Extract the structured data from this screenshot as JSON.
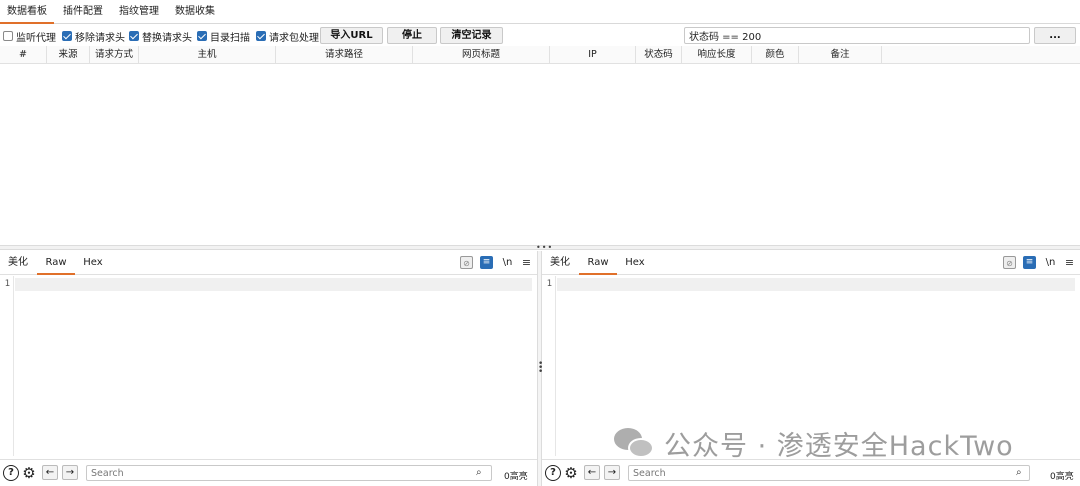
{
  "tabs": [
    {
      "label": "数据看板",
      "active": true
    },
    {
      "label": "插件配置",
      "active": false
    },
    {
      "label": "指纹管理",
      "active": false
    },
    {
      "label": "数据收集",
      "active": false
    }
  ],
  "toolbar": {
    "checkboxes": [
      {
        "label": "监听代理",
        "checked": false
      },
      {
        "label": "移除请求头",
        "checked": true
      },
      {
        "label": "替换请求头",
        "checked": true
      },
      {
        "label": "目录扫描",
        "checked": true
      },
      {
        "label": "请求包处理",
        "checked": true
      }
    ],
    "import_label": "导入URL",
    "stop_label": "停止",
    "clear_label": "清空记录",
    "filter_value": "状态码 == 200",
    "more_label": "..."
  },
  "table": {
    "columns": [
      "#",
      "来源",
      "请求方式",
      "主机",
      "请求路径",
      "网页标题",
      "IP",
      "状态码",
      "响应长度",
      "颜色",
      "备注"
    ],
    "rows": []
  },
  "left_pane": {
    "tabs": [
      {
        "label": "美化",
        "active": false
      },
      {
        "label": "Raw",
        "active": true
      },
      {
        "label": "Hex",
        "active": false
      }
    ],
    "newline_label": "\\n",
    "line_number": "1",
    "search_placeholder": "Search",
    "highlight_count": "0高亮"
  },
  "right_pane": {
    "tabs": [
      {
        "label": "美化",
        "active": false
      },
      {
        "label": "Raw",
        "active": true
      },
      {
        "label": "Hex",
        "active": false
      }
    ],
    "newline_label": "\\n",
    "line_number": "1",
    "search_placeholder": "Search",
    "highlight_count": "0高亮"
  },
  "watermark": {
    "text": "公众号 · 渗透安全HackTwo"
  },
  "colors": {
    "accent": "#e0702a",
    "checkbox_blue": "#2a6db5"
  },
  "icons": [
    "eye-off-icon",
    "wrap-icon",
    "menu-icon",
    "help-icon",
    "gear-icon",
    "arrow-left-icon",
    "arrow-right-icon",
    "search-icon",
    "wechat-logo-icon"
  ]
}
